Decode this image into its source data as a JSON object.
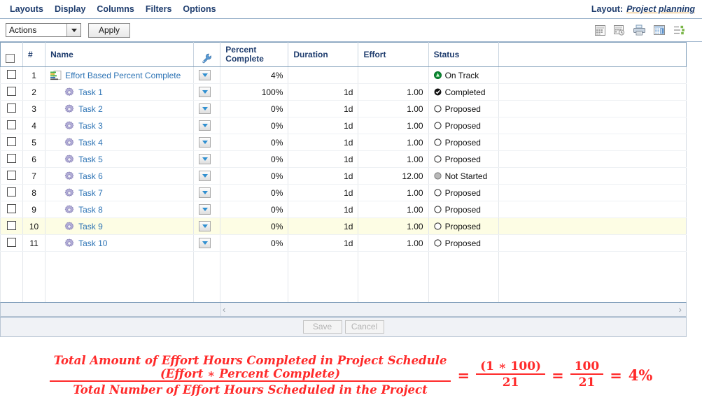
{
  "menu": {
    "items": [
      "Layouts",
      "Display",
      "Columns",
      "Filters",
      "Options"
    ],
    "layout_label": "Layout:",
    "layout_value": "Project planning"
  },
  "actionbar": {
    "select_value": "Actions",
    "apply_label": "Apply",
    "tool_icons": [
      "grid-icon",
      "grid-clock-icon",
      "print-icon",
      "column-layout-icon",
      "list-settings-icon"
    ]
  },
  "grid": {
    "columns": [
      {
        "key": "check",
        "label": ""
      },
      {
        "key": "num",
        "label": "#"
      },
      {
        "key": "name",
        "label": "Name"
      },
      {
        "key": "wrench",
        "label": ""
      },
      {
        "key": "percent",
        "label": "Percent\nComplete"
      },
      {
        "key": "duration",
        "label": "Duration"
      },
      {
        "key": "effort",
        "label": "Effort"
      },
      {
        "key": "status",
        "label": "Status"
      },
      {
        "key": "blank",
        "label": ""
      }
    ],
    "rows": [
      {
        "num": "1",
        "name": "Effort Based Percent Complete",
        "icon": "project-icon",
        "indent": false,
        "percent": "4%",
        "duration": "",
        "effort": "",
        "status": "On Track",
        "status_icon": "on-track-icon",
        "highlight": false
      },
      {
        "num": "2",
        "name": "Task 1",
        "icon": "task-gear-icon",
        "indent": true,
        "percent": "100%",
        "duration": "1d",
        "effort": "1.00",
        "status": "Completed",
        "status_icon": "completed-icon",
        "highlight": false
      },
      {
        "num": "3",
        "name": "Task 2",
        "icon": "task-gear-icon",
        "indent": true,
        "percent": "0%",
        "duration": "1d",
        "effort": "1.00",
        "status": "Proposed",
        "status_icon": "proposed-icon",
        "highlight": false
      },
      {
        "num": "4",
        "name": "Task 3",
        "icon": "task-gear-icon",
        "indent": true,
        "percent": "0%",
        "duration": "1d",
        "effort": "1.00",
        "status": "Proposed",
        "status_icon": "proposed-icon",
        "highlight": false
      },
      {
        "num": "5",
        "name": "Task 4",
        "icon": "task-gear-icon",
        "indent": true,
        "percent": "0%",
        "duration": "1d",
        "effort": "1.00",
        "status": "Proposed",
        "status_icon": "proposed-icon",
        "highlight": false
      },
      {
        "num": "6",
        "name": "Task 5",
        "icon": "task-gear-icon",
        "indent": true,
        "percent": "0%",
        "duration": "1d",
        "effort": "1.00",
        "status": "Proposed",
        "status_icon": "proposed-icon",
        "highlight": false
      },
      {
        "num": "7",
        "name": "Task 6",
        "icon": "task-gear-icon",
        "indent": true,
        "percent": "0%",
        "duration": "1d",
        "effort": "12.00",
        "status": "Not Started",
        "status_icon": "not-started-icon",
        "highlight": false
      },
      {
        "num": "8",
        "name": "Task 7",
        "icon": "task-gear-icon",
        "indent": true,
        "percent": "0%",
        "duration": "1d",
        "effort": "1.00",
        "status": "Proposed",
        "status_icon": "proposed-icon",
        "highlight": false
      },
      {
        "num": "9",
        "name": "Task 8",
        "icon": "task-gear-icon",
        "indent": true,
        "percent": "0%",
        "duration": "1d",
        "effort": "1.00",
        "status": "Proposed",
        "status_icon": "proposed-icon",
        "highlight": false
      },
      {
        "num": "10",
        "name": "Task 9",
        "icon": "task-gear-icon",
        "indent": true,
        "percent": "0%",
        "duration": "1d",
        "effort": "1.00",
        "status": "Proposed",
        "status_icon": "proposed-icon",
        "highlight": true
      },
      {
        "num": "11",
        "name": "Task 10",
        "icon": "task-gear-icon",
        "indent": true,
        "percent": "0%",
        "duration": "1d",
        "effort": "1.00",
        "status": "Proposed",
        "status_icon": "proposed-icon",
        "highlight": false
      }
    ]
  },
  "scrollbar": {
    "left_arrow": "‹",
    "right_arrow": "›"
  },
  "footer": {
    "save_label": "Save",
    "cancel_label": "Cancel"
  },
  "formula": {
    "numerator_line1": "Total Amount of Effort Hours Completed in Project Schedule",
    "numerator_line2": "(Effort ∗ Percent Complete)",
    "denominator": "Total Number of Effort Hours Scheduled in the Project",
    "equals1": "=",
    "frac2_num": "(1 ∗ 100)",
    "frac2_den": "21",
    "equals2": "=",
    "frac3_num": "100",
    "frac3_den": "21",
    "equals3": "=",
    "result": "4%",
    "color": "#ff2a2a"
  },
  "colors": {
    "menu_text": "#1f3d6e",
    "link": "#2e74b5",
    "row_separator_green": "#7fe07f",
    "highlight_row": "#fdfde4",
    "status_on_track": "#0a8a32",
    "formula_red": "#ff2a2a"
  }
}
